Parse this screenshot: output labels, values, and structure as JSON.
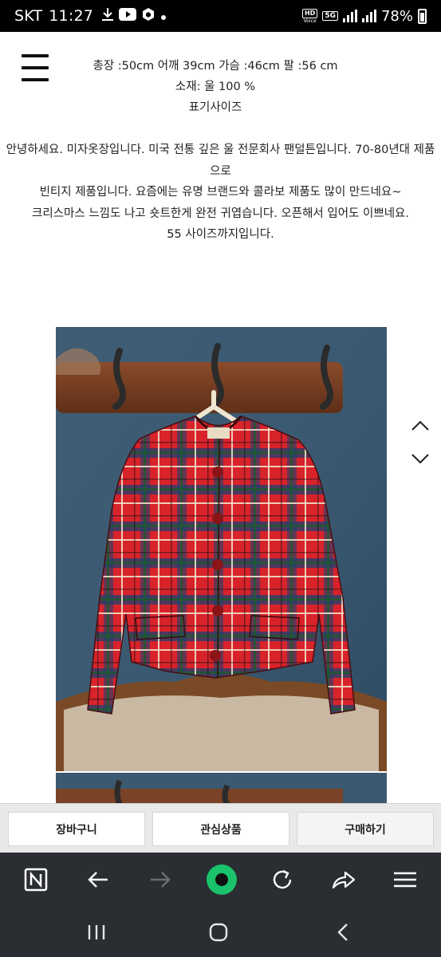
{
  "status_bar": {
    "carrier": "SKT",
    "time": "11:27",
    "network": "5G",
    "hd_badge": "HD",
    "voice_label": "Voice",
    "battery": "78%",
    "icons": [
      "download-icon",
      "youtube-icon",
      "cube-app-icon",
      "dot-icon",
      "signal-icon",
      "battery-icon"
    ]
  },
  "product": {
    "spec_line1": "총장 :50cm 어깨 39cm  가슴 :46cm  팔 :56 cm",
    "spec_line2": "소재:  울 100  %",
    "spec_line3": "표기사이즈",
    "description": [
      "안녕하세요. 미자옷장입니다. 미국 전통 깊은  울 전문회사 팬덜튼입니다.  70-80년대 제품으로",
      "빈티지 제품입니다.  요즘에는  유명 브랜드와  콜라보 제품도 많이 만드네요~",
      "크리스마스 느낌도 나고  숏트한게 완전 귀엽습니다.  오픈해서 입어도 이쁘네요.",
      "55 사이즈까지입니다."
    ]
  },
  "actions": {
    "cart_label": "장바구니",
    "wishlist_label": "관심상품",
    "buy_label": "구매하기"
  },
  "browser_toolbar": {
    "icons": [
      "naver-n-icon",
      "back-arrow-icon",
      "forward-arrow-icon",
      "home-green-icon",
      "refresh-icon",
      "share-icon",
      "menu-icon"
    ]
  },
  "system_nav": {
    "icons": [
      "recent-apps-icon",
      "home-icon",
      "back-icon"
    ]
  },
  "colors": {
    "accent_green": "#19c26b",
    "toolbar_bg": "#2a2d32",
    "plaid_red": "#d8232b"
  }
}
